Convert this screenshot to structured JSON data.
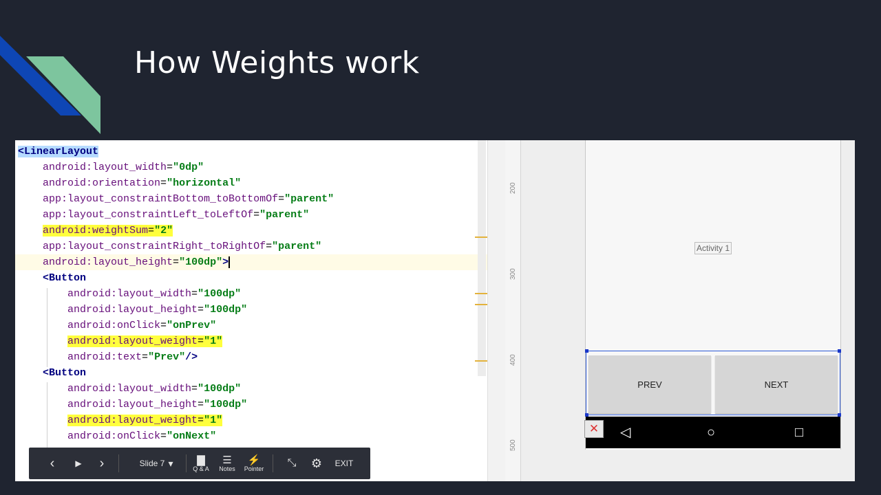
{
  "slide": {
    "title": "How Weights work",
    "colors": {
      "background": "#1f2430",
      "accent_blue": "#0e46b5",
      "accent_green": "#7dc59e"
    }
  },
  "code": {
    "lines": [
      {
        "parts": [
          {
            "t": "<LinearLayout",
            "c": "tag hlblue"
          }
        ]
      },
      {
        "parts": [
          {
            "t": "    "
          },
          {
            "t": "android:layout_width",
            "c": "attr"
          },
          {
            "t": "=",
            "c": "punct"
          },
          {
            "t": "\"0dp\"",
            "c": "val"
          }
        ]
      },
      {
        "parts": [
          {
            "t": "    "
          },
          {
            "t": "android:orientation",
            "c": "attr"
          },
          {
            "t": "=",
            "c": "punct"
          },
          {
            "t": "\"horizontal\"",
            "c": "val"
          }
        ]
      },
      {
        "parts": [
          {
            "t": "    "
          },
          {
            "t": "app:layout_constraintBottom_toBottomOf",
            "c": "attr"
          },
          {
            "t": "=",
            "c": "punct"
          },
          {
            "t": "\"parent\"",
            "c": "val"
          }
        ]
      },
      {
        "parts": [
          {
            "t": "    "
          },
          {
            "t": "app:layout_constraintLeft_toLeftOf",
            "c": "attr"
          },
          {
            "t": "=",
            "c": "punct"
          },
          {
            "t": "\"parent\"",
            "c": "val"
          }
        ]
      },
      {
        "parts": [
          {
            "t": "    "
          },
          {
            "t": "android:weightSum",
            "c": "attr hl"
          },
          {
            "t": "=",
            "c": "punct hl"
          },
          {
            "t": "\"2\"",
            "c": "val hl"
          }
        ]
      },
      {
        "parts": [
          {
            "t": "    "
          },
          {
            "t": "app:layout_constraintRight_toRightOf",
            "c": "attr"
          },
          {
            "t": "=",
            "c": "punct"
          },
          {
            "t": "\"parent\"",
            "c": "val"
          }
        ]
      },
      {
        "current": true,
        "caret": true,
        "parts": [
          {
            "t": "    "
          },
          {
            "t": "android:layout_height",
            "c": "attr"
          },
          {
            "t": "=",
            "c": "punct"
          },
          {
            "t": "\"100dp\"",
            "c": "val"
          },
          {
            "t": ">",
            "c": "tag"
          }
        ]
      },
      {
        "parts": [
          {
            "t": "    "
          },
          {
            "t": "<Button",
            "c": "tag"
          }
        ]
      },
      {
        "parts": [
          {
            "t": "        "
          },
          {
            "t": "android:layout_width",
            "c": "attr"
          },
          {
            "t": "=",
            "c": "punct"
          },
          {
            "t": "\"100dp\"",
            "c": "val"
          }
        ]
      },
      {
        "parts": [
          {
            "t": "        "
          },
          {
            "t": "android:layout_height",
            "c": "attr"
          },
          {
            "t": "=",
            "c": "punct"
          },
          {
            "t": "\"100dp\"",
            "c": "val"
          }
        ]
      },
      {
        "parts": [
          {
            "t": "        "
          },
          {
            "t": "android:onClick",
            "c": "attr"
          },
          {
            "t": "=",
            "c": "punct"
          },
          {
            "t": "\"onPrev\"",
            "c": "val"
          }
        ]
      },
      {
        "parts": [
          {
            "t": "        "
          },
          {
            "t": "android:layout_weight",
            "c": "attr hl"
          },
          {
            "t": "=",
            "c": "punct hl"
          },
          {
            "t": "\"1\"",
            "c": "val hl"
          }
        ]
      },
      {
        "parts": [
          {
            "t": "        "
          },
          {
            "t": "android:text",
            "c": "attr"
          },
          {
            "t": "=",
            "c": "punct"
          },
          {
            "t": "\"Prev\"",
            "c": "val"
          },
          {
            "t": "/>",
            "c": "tag"
          }
        ]
      },
      {
        "parts": [
          {
            "t": "    "
          },
          {
            "t": "<Button",
            "c": "tag"
          }
        ]
      },
      {
        "parts": [
          {
            "t": "        "
          },
          {
            "t": "android:layout_width",
            "c": "attr"
          },
          {
            "t": "=",
            "c": "punct"
          },
          {
            "t": "\"100dp\"",
            "c": "val"
          }
        ]
      },
      {
        "parts": [
          {
            "t": "        "
          },
          {
            "t": "android:layout_height",
            "c": "attr"
          },
          {
            "t": "=",
            "c": "punct"
          },
          {
            "t": "\"100dp\"",
            "c": "val"
          }
        ]
      },
      {
        "parts": [
          {
            "t": "        "
          },
          {
            "t": "android:layout_weight",
            "c": "attr hl"
          },
          {
            "t": "=",
            "c": "punct hl"
          },
          {
            "t": "\"1\"",
            "c": "val hl"
          }
        ]
      },
      {
        "parts": [
          {
            "t": "        "
          },
          {
            "t": "android:onClick",
            "c": "attr"
          },
          {
            "t": "=",
            "c": "punct"
          },
          {
            "t": "\"onNext\"",
            "c": "val"
          }
        ]
      }
    ]
  },
  "design": {
    "ruler_ticks": [
      "200",
      "300",
      "400",
      "500"
    ],
    "activity_label": "Activity 1",
    "prev_label": "PREV",
    "next_label": "NEXT",
    "nav_back": "◁",
    "nav_home": "○",
    "nav_recent": "□",
    "error_badge": "✕"
  },
  "presenter": {
    "slide_label": "Slide 7",
    "qa_label": "Q & A",
    "notes_label": "Notes",
    "pointer_label": "Pointer",
    "exit_label": "EXIT",
    "prev_icon": "‹",
    "play_icon": "▶",
    "next_icon": "›",
    "dropdown_icon": "▾",
    "collapse_icon": "⤡",
    "settings_icon": "⚙",
    "qa_icon": "▇",
    "notes_icon": "☰",
    "pointer_icon": "⚡"
  }
}
